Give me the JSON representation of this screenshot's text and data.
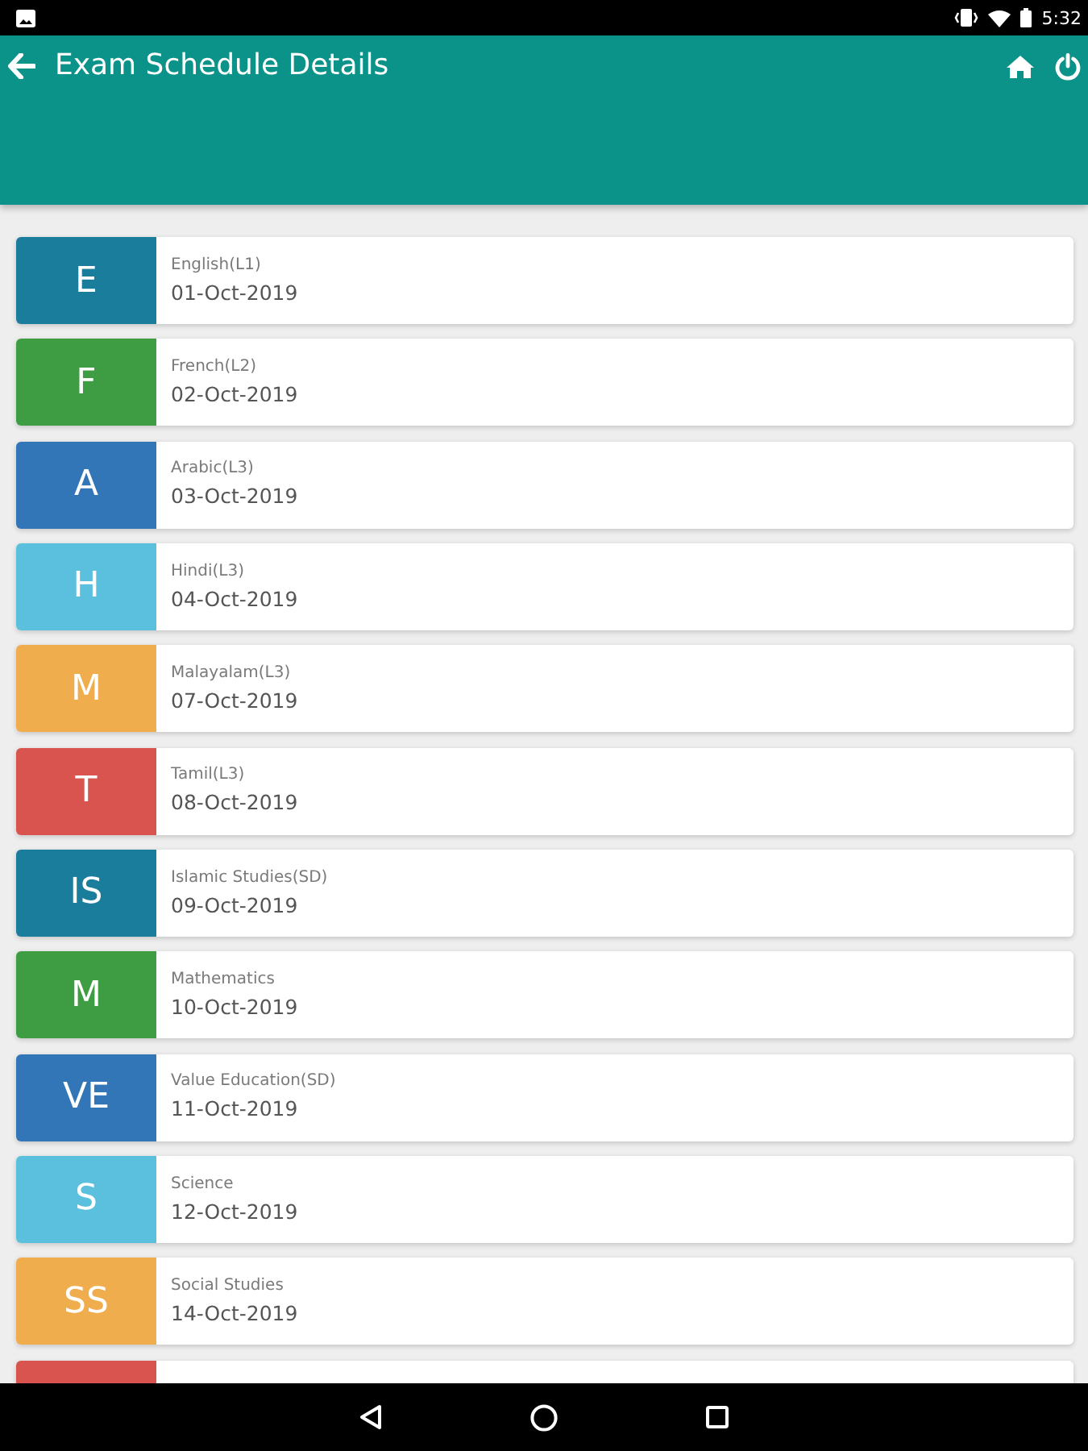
{
  "status_bar": {
    "time": "5:32"
  },
  "toolbar": {
    "title": "Exam Schedule Details"
  },
  "exams": [
    {
      "initials": "E",
      "subject": "English(L1)",
      "date": "01-Oct-2019",
      "color": "#1b7d9c"
    },
    {
      "initials": "F",
      "subject": "French(L2)",
      "date": "02-Oct-2019",
      "color": "#3e9c42"
    },
    {
      "initials": "A",
      "subject": "Arabic(L3)",
      "date": "03-Oct-2019",
      "color": "#3276b8"
    },
    {
      "initials": "H",
      "subject": "Hindi(L3)",
      "date": "04-Oct-2019",
      "color": "#5bc0de"
    },
    {
      "initials": "M",
      "subject": "Malayalam(L3)",
      "date": "07-Oct-2019",
      "color": "#f0ad4e"
    },
    {
      "initials": "T",
      "subject": "Tamil(L3)",
      "date": "08-Oct-2019",
      "color": "#d9534f"
    },
    {
      "initials": "IS",
      "subject": "Islamic Studies(SD)",
      "date": "09-Oct-2019",
      "color": "#1b7d9c"
    },
    {
      "initials": "M",
      "subject": "Mathematics",
      "date": "10-Oct-2019",
      "color": "#3e9c42"
    },
    {
      "initials": "VE",
      "subject": "Value Education(SD)",
      "date": "11-Oct-2019",
      "color": "#3276b8"
    },
    {
      "initials": "S",
      "subject": "Science",
      "date": "12-Oct-2019",
      "color": "#5bc0de"
    },
    {
      "initials": "SS",
      "subject": "Social Studies",
      "date": "14-Oct-2019",
      "color": "#f0ad4e"
    },
    {
      "color": "#d9534f"
    }
  ]
}
